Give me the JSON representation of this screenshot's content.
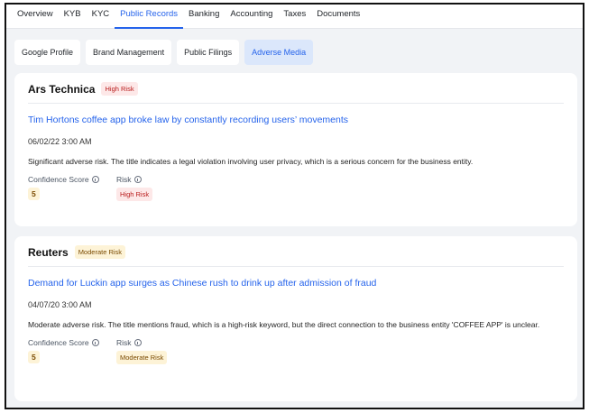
{
  "top_tabs": [
    "Overview",
    "KYB",
    "KYC",
    "Public Records",
    "Banking",
    "Accounting",
    "Taxes",
    "Documents"
  ],
  "active_top_tab": "Public Records",
  "sub_tabs": [
    "Google Profile",
    "Brand Management",
    "Public Filings",
    "Adverse Media"
  ],
  "active_sub_tab": "Adverse Media",
  "labels": {
    "confidence_score": "Confidence Score",
    "risk": "Risk"
  },
  "articles": [
    {
      "source": "Ars Technica",
      "risk_badge": "High Risk",
      "headline": "Tim Hortons coffee app broke law by constantly recording users’ movements",
      "date": "06/02/22 3:00 AM",
      "description": "Significant adverse risk. The title indicates a legal violation involving user privacy, which is a serious concern for the business entity.",
      "confidence_score": "5",
      "risk": "High Risk"
    },
    {
      "source": "Reuters",
      "risk_badge": "Moderate Risk",
      "headline": "Demand for Luckin app surges as Chinese rush to drink up after admission of fraud",
      "date": "04/07/20 3:00 AM",
      "description": "Moderate adverse risk. The title mentions fraud, which is a high-risk keyword, but the direct connection to the business entity 'COFFEE APP' is unclear.",
      "confidence_score": "5",
      "risk": "Moderate Risk"
    }
  ],
  "colors": {
    "accent": "#2563eb",
    "high_risk_bg": "#fde8e8",
    "high_risk_text": "#b91c1c",
    "moderate_risk_bg": "#fdf3d7",
    "moderate_risk_text": "#7a4a00",
    "panel_bg": "#f1f3f6"
  }
}
